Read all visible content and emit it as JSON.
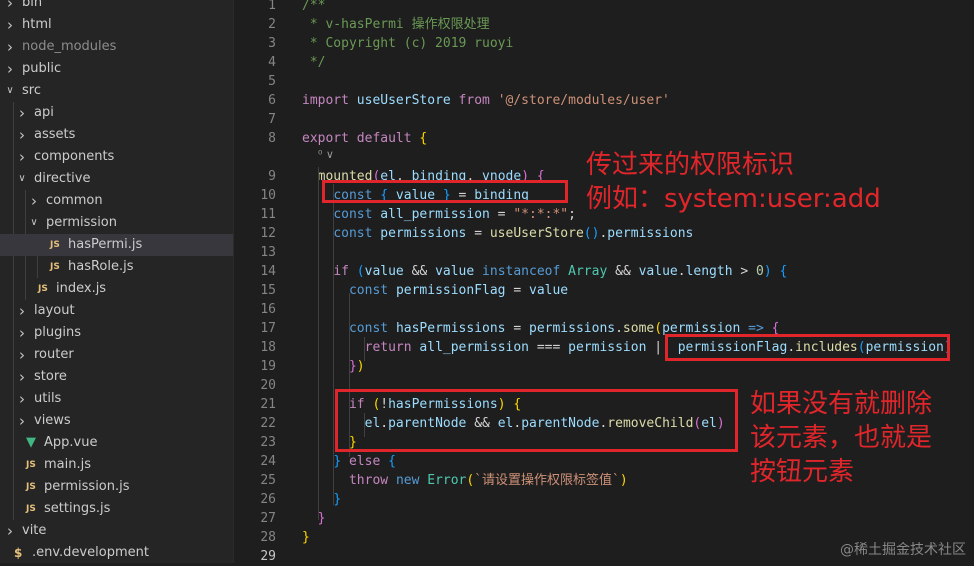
{
  "explorer": {
    "items": [
      {
        "label": "bin",
        "type": "folder",
        "depth": 0,
        "open": false
      },
      {
        "label": "html",
        "type": "folder",
        "depth": 0,
        "open": false
      },
      {
        "label": "node_modules",
        "type": "folder",
        "depth": 0,
        "open": false,
        "dim": true
      },
      {
        "label": "public",
        "type": "folder",
        "depth": 0,
        "open": false
      },
      {
        "label": "src",
        "type": "folder",
        "depth": 0,
        "open": true
      },
      {
        "label": "api",
        "type": "folder",
        "depth": 1,
        "open": false
      },
      {
        "label": "assets",
        "type": "folder",
        "depth": 1,
        "open": false
      },
      {
        "label": "components",
        "type": "folder",
        "depth": 1,
        "open": false
      },
      {
        "label": "directive",
        "type": "folder",
        "depth": 1,
        "open": true
      },
      {
        "label": "common",
        "type": "folder",
        "depth": 2,
        "open": false
      },
      {
        "label": "permission",
        "type": "folder",
        "depth": 2,
        "open": true
      },
      {
        "label": "hasPermi.js",
        "type": "js",
        "depth": 3,
        "selected": true
      },
      {
        "label": "hasRole.js",
        "type": "js",
        "depth": 3
      },
      {
        "label": "index.js",
        "type": "js",
        "depth": 2
      },
      {
        "label": "layout",
        "type": "folder",
        "depth": 1,
        "open": false
      },
      {
        "label": "plugins",
        "type": "folder",
        "depth": 1,
        "open": false
      },
      {
        "label": "router",
        "type": "folder",
        "depth": 1,
        "open": false
      },
      {
        "label": "store",
        "type": "folder",
        "depth": 1,
        "open": false
      },
      {
        "label": "utils",
        "type": "folder",
        "depth": 1,
        "open": false
      },
      {
        "label": "views",
        "type": "folder",
        "depth": 1,
        "open": false
      },
      {
        "label": "App.vue",
        "type": "vue",
        "depth": 1
      },
      {
        "label": "main.js",
        "type": "js",
        "depth": 1
      },
      {
        "label": "permission.js",
        "type": "js",
        "depth": 1
      },
      {
        "label": "settings.js",
        "type": "js",
        "depth": 1
      },
      {
        "label": "vite",
        "type": "folder",
        "depth": 0,
        "open": false
      },
      {
        "label": ".env.development",
        "type": "env",
        "depth": 0
      }
    ]
  },
  "icons": {
    "chevron_right": "chevron-right-icon",
    "chevron_down": "chevron-down-icon",
    "js": "js-file-icon",
    "vue": "vue-file-icon",
    "env": "env-file-icon"
  },
  "editor": {
    "codelens_text": "⁰ ∨",
    "lines": [
      {
        "n": 1,
        "tokens": [
          [
            "/**",
            "t-comment"
          ]
        ]
      },
      {
        "n": 2,
        "tokens": [
          [
            " * v-hasPermi 操作权限处理",
            "t-comment"
          ]
        ]
      },
      {
        "n": 3,
        "tokens": [
          [
            " * Copyright (c) 2019 ruoyi",
            "t-comment"
          ]
        ]
      },
      {
        "n": 4,
        "tokens": [
          [
            " */",
            "t-comment"
          ]
        ]
      },
      {
        "n": 5,
        "tokens": []
      },
      {
        "n": 6,
        "tokens": [
          [
            "import",
            "t-ctrl"
          ],
          [
            " ",
            "t-plain"
          ],
          [
            "useUserStore",
            "t-var"
          ],
          [
            " ",
            "t-plain"
          ],
          [
            "from",
            "t-ctrl"
          ],
          [
            " ",
            "t-plain"
          ],
          [
            "'@/store/modules/user'",
            "t-str"
          ]
        ]
      },
      {
        "n": 7,
        "tokens": []
      },
      {
        "n": 8,
        "tokens": [
          [
            "export",
            "t-ctrl"
          ],
          [
            " ",
            "t-plain"
          ],
          [
            "default",
            "t-ctrl"
          ],
          [
            " ",
            "t-plain"
          ],
          [
            "{",
            "t-brace1"
          ]
        ]
      },
      {
        "n": 9,
        "tokens": [
          [
            "  ",
            "t-plain"
          ],
          [
            "mounted",
            "t-fn"
          ],
          [
            "(",
            "t-brace2"
          ],
          [
            "el",
            "t-var"
          ],
          [
            ", ",
            "t-plain"
          ],
          [
            "binding",
            "t-var"
          ],
          [
            ", ",
            "t-plain"
          ],
          [
            "vnode",
            "t-var"
          ],
          [
            ")",
            "t-brace2"
          ],
          [
            " ",
            "t-plain"
          ],
          [
            "{",
            "t-brace2"
          ]
        ]
      },
      {
        "n": 10,
        "tokens": [
          [
            "    ",
            "t-plain"
          ],
          [
            "const",
            "t-kw"
          ],
          [
            " ",
            "t-plain"
          ],
          [
            "{",
            "t-brace3"
          ],
          [
            " value ",
            "t-var"
          ],
          [
            "}",
            "t-brace3"
          ],
          [
            " = ",
            "t-plain"
          ],
          [
            "binding",
            "t-var"
          ]
        ]
      },
      {
        "n": 11,
        "tokens": [
          [
            "    ",
            "t-plain"
          ],
          [
            "const",
            "t-kw"
          ],
          [
            " ",
            "t-plain"
          ],
          [
            "all_permission",
            "t-var"
          ],
          [
            " = ",
            "t-plain"
          ],
          [
            "\"*:*:*\"",
            "t-str"
          ],
          [
            ";",
            "t-plain"
          ]
        ]
      },
      {
        "n": 12,
        "tokens": [
          [
            "    ",
            "t-plain"
          ],
          [
            "const",
            "t-kw"
          ],
          [
            " ",
            "t-plain"
          ],
          [
            "permissions",
            "t-var"
          ],
          [
            " = ",
            "t-plain"
          ],
          [
            "useUserStore",
            "t-fn"
          ],
          [
            "()",
            "t-brace3"
          ],
          [
            ".",
            "t-plain"
          ],
          [
            "permissions",
            "t-var"
          ]
        ]
      },
      {
        "n": 13,
        "tokens": []
      },
      {
        "n": 14,
        "tokens": [
          [
            "    ",
            "t-plain"
          ],
          [
            "if",
            "t-ctrl"
          ],
          [
            " ",
            "t-plain"
          ],
          [
            "(",
            "t-brace3"
          ],
          [
            "value",
            "t-var"
          ],
          [
            " && ",
            "t-plain"
          ],
          [
            "value",
            "t-var"
          ],
          [
            " ",
            "t-plain"
          ],
          [
            "instanceof",
            "t-kw"
          ],
          [
            " ",
            "t-plain"
          ],
          [
            "Array",
            "t-type"
          ],
          [
            " && ",
            "t-plain"
          ],
          [
            "value",
            "t-var"
          ],
          [
            ".",
            "t-plain"
          ],
          [
            "length",
            "t-var"
          ],
          [
            " > ",
            "t-plain"
          ],
          [
            "0",
            "t-num"
          ],
          [
            ")",
            "t-brace3"
          ],
          [
            " ",
            "t-plain"
          ],
          [
            "{",
            "t-brace3"
          ]
        ]
      },
      {
        "n": 15,
        "tokens": [
          [
            "      ",
            "t-plain"
          ],
          [
            "const",
            "t-kw"
          ],
          [
            " ",
            "t-plain"
          ],
          [
            "permissionFlag",
            "t-var"
          ],
          [
            " = ",
            "t-plain"
          ],
          [
            "value",
            "t-var"
          ]
        ]
      },
      {
        "n": 16,
        "tokens": []
      },
      {
        "n": 17,
        "tokens": [
          [
            "      ",
            "t-plain"
          ],
          [
            "const",
            "t-kw"
          ],
          [
            " ",
            "t-plain"
          ],
          [
            "hasPermissions",
            "t-var"
          ],
          [
            " = ",
            "t-plain"
          ],
          [
            "permissions",
            "t-var"
          ],
          [
            ".",
            "t-plain"
          ],
          [
            "some",
            "t-fn"
          ],
          [
            "(",
            "t-brace1"
          ],
          [
            "permission",
            "t-var"
          ],
          [
            " ",
            "t-plain"
          ],
          [
            "=>",
            "t-kw"
          ],
          [
            " ",
            "t-plain"
          ],
          [
            "{",
            "t-brace2"
          ]
        ]
      },
      {
        "n": 18,
        "tokens": [
          [
            "        ",
            "t-plain"
          ],
          [
            "return",
            "t-ctrl"
          ],
          [
            " ",
            "t-plain"
          ],
          [
            "all_permission",
            "t-var"
          ],
          [
            " === ",
            "t-plain"
          ],
          [
            "permission",
            "t-var"
          ],
          [
            " || ",
            "t-plain"
          ],
          [
            "permissionFlag",
            "t-var"
          ],
          [
            ".",
            "t-plain"
          ],
          [
            "includes",
            "t-fn"
          ],
          [
            "(",
            "t-brace3"
          ],
          [
            "permission",
            "t-var"
          ],
          [
            ")",
            "t-brace3"
          ]
        ]
      },
      {
        "n": 19,
        "tokens": [
          [
            "      ",
            "t-plain"
          ],
          [
            "}",
            "t-brace2"
          ],
          [
            ")",
            "t-brace1"
          ]
        ]
      },
      {
        "n": 20,
        "tokens": []
      },
      {
        "n": 21,
        "tokens": [
          [
            "      ",
            "t-plain"
          ],
          [
            "if",
            "t-ctrl"
          ],
          [
            " ",
            "t-plain"
          ],
          [
            "(",
            "t-brace1"
          ],
          [
            "!",
            "t-plain"
          ],
          [
            "hasPermissions",
            "t-var"
          ],
          [
            ")",
            "t-brace1"
          ],
          [
            " ",
            "t-plain"
          ],
          [
            "{",
            "t-brace1"
          ]
        ]
      },
      {
        "n": 22,
        "tokens": [
          [
            "        ",
            "t-plain"
          ],
          [
            "el",
            "t-var"
          ],
          [
            ".",
            "t-plain"
          ],
          [
            "parentNode",
            "t-var"
          ],
          [
            " && ",
            "t-plain"
          ],
          [
            "el",
            "t-var"
          ],
          [
            ".",
            "t-plain"
          ],
          [
            "parentNode",
            "t-var"
          ],
          [
            ".",
            "t-plain"
          ],
          [
            "removeChild",
            "t-fn"
          ],
          [
            "(",
            "t-brace2"
          ],
          [
            "el",
            "t-var"
          ],
          [
            ")",
            "t-brace2"
          ]
        ]
      },
      {
        "n": 23,
        "tokens": [
          [
            "      ",
            "t-plain"
          ],
          [
            "}",
            "t-brace1"
          ]
        ]
      },
      {
        "n": 24,
        "tokens": [
          [
            "    ",
            "t-plain"
          ],
          [
            "}",
            "t-brace3"
          ],
          [
            " ",
            "t-plain"
          ],
          [
            "else",
            "t-ctrl"
          ],
          [
            " ",
            "t-plain"
          ],
          [
            "{",
            "t-brace3"
          ]
        ]
      },
      {
        "n": 25,
        "tokens": [
          [
            "      ",
            "t-plain"
          ],
          [
            "throw",
            "t-ctrl"
          ],
          [
            " ",
            "t-plain"
          ],
          [
            "new",
            "t-kw"
          ],
          [
            " ",
            "t-plain"
          ],
          [
            "Error",
            "t-type"
          ],
          [
            "(",
            "t-brace1"
          ],
          [
            "`请设置操作权限标签值`",
            "t-str"
          ],
          [
            ")",
            "t-brace1"
          ]
        ]
      },
      {
        "n": 26,
        "tokens": [
          [
            "    ",
            "t-plain"
          ],
          [
            "}",
            "t-brace3"
          ]
        ]
      },
      {
        "n": 27,
        "tokens": [
          [
            "  ",
            "t-plain"
          ],
          [
            "}",
            "t-brace2"
          ]
        ]
      },
      {
        "n": 28,
        "tokens": [
          [
            "}",
            "t-brace1"
          ]
        ]
      },
      {
        "n": 29,
        "tokens": []
      }
    ],
    "active_line": 29
  },
  "annotations": {
    "binding_note": "传过来的权限标识\n例如：system:user:add",
    "remove_note": "如果没有就删除\n该元素，也就是\n按钮元素"
  },
  "watermark": "@稀土掘金技术社区",
  "colors": {
    "annotation_red": "#e0262b",
    "selected_bg": "#37373d"
  }
}
